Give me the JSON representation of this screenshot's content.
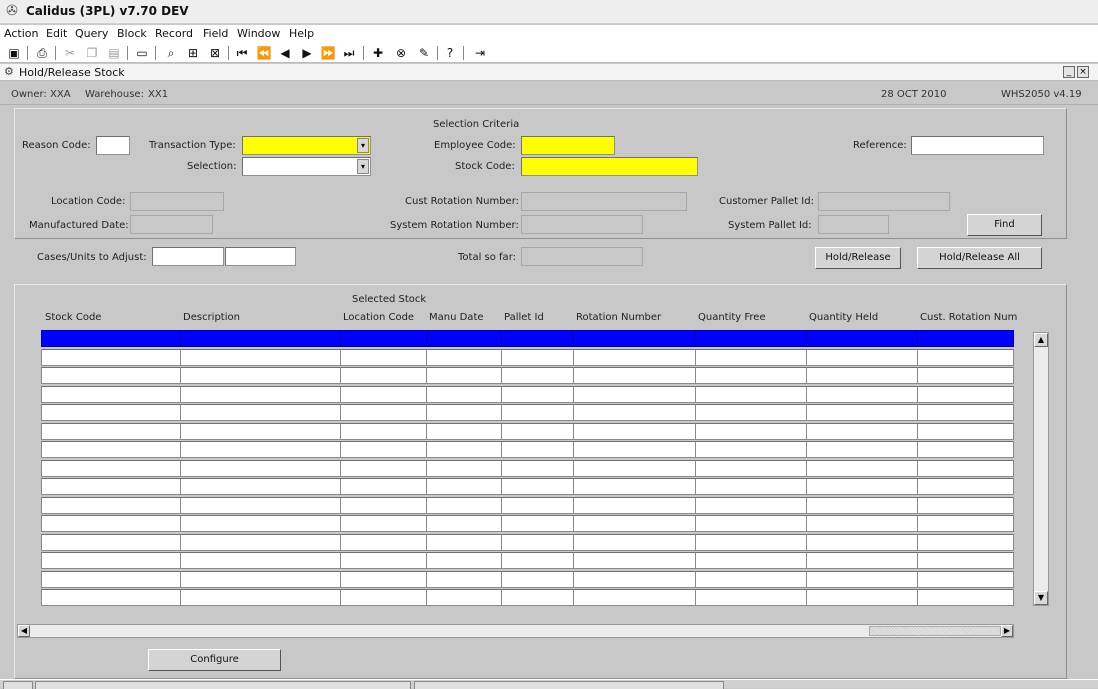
{
  "app": {
    "title": "Calidus (3PL) v7.70 DEV",
    "icon": "calidus-app-icon"
  },
  "menu": [
    "Action",
    "Edit",
    "Query",
    "Block",
    "Record",
    "Field",
    "Window",
    "Help"
  ],
  "toolbar": {
    "icons": [
      "save-icon",
      "print-icon",
      "cut-icon",
      "copy-icon",
      "paste-icon",
      "clear-icon",
      "enter-query-icon",
      "execute-query-icon",
      "cancel-query-icon",
      "first-record-icon",
      "previous-block-icon",
      "previous-record-icon",
      "next-record-icon",
      "next-block-icon",
      "last-record-icon",
      "insert-record-icon",
      "delete-record-icon",
      "clear-record-icon",
      "help-icon",
      "exit-icon"
    ]
  },
  "window": {
    "title": "Hold/Release Stock",
    "minimize": "_",
    "close": "×"
  },
  "info": {
    "owner_label": "Owner:",
    "owner_value": "XXA",
    "warehouse_label": "Warehouse:",
    "warehouse_value": "XX1",
    "date": "28 OCT 2010",
    "form_version": "WHS2050  v4.19"
  },
  "criteria": {
    "title": "Selection Criteria",
    "reason_code_label": "Reason Code:",
    "reason_code_value": "",
    "transaction_type_label": "Transaction Type:",
    "transaction_type_value": "",
    "selection_label": "Selection:",
    "selection_value": "",
    "employee_code_label": "Employee Code:",
    "employee_code_value": "",
    "stock_code_label": "Stock Code:",
    "stock_code_value": "",
    "reference_label": "Reference:",
    "reference_value": "",
    "location_code_label": "Location Code:",
    "location_code_value": "",
    "manufactured_date_label": "Manufactured Date:",
    "manufactured_date_value": "",
    "cust_rotation_label": "Cust Rotation Number:",
    "cust_rotation_value": "",
    "system_rotation_label": "System Rotation Number:",
    "system_rotation_value": "",
    "customer_pallet_label": "Customer Pallet Id:",
    "customer_pallet_value": "",
    "system_pallet_label": "System Pallet Id:",
    "system_pallet_value": "",
    "find_button": "Find"
  },
  "adjust": {
    "cases_units_label": "Cases/Units to Adjust:",
    "cases_value": "",
    "units_value": "",
    "total_so_far_label": "Total so far:",
    "total_so_far_value": "",
    "hold_release_button": "Hold/Release",
    "hold_release_all_button": "Hold/Release All"
  },
  "stock_grid": {
    "title": "Selected Stock",
    "columns": [
      "Stock Code",
      "Description",
      "Location Code",
      "Manu Date",
      "Pallet Id",
      "Rotation Number",
      "Quantity Free",
      "Quantity Held",
      "Cust. Rotation Num"
    ],
    "row_count": 15,
    "selected_row": 0
  },
  "configure_button": "Configure",
  "colors": {
    "selected_row": "#0000ff",
    "mandatory_field": "#ffff00",
    "background": "#c8c8c8"
  }
}
